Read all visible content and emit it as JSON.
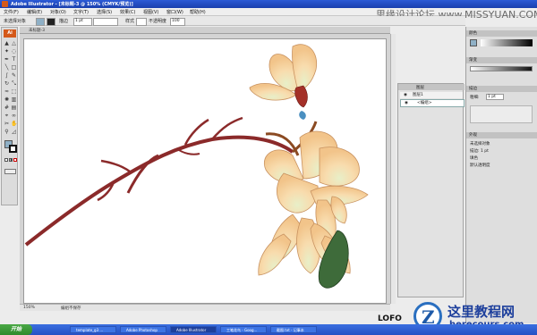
{
  "window": {
    "title": "Adobe Illustrator - [未标题-3 @ 150% (CMYK/预览)]"
  },
  "menu": [
    "文件(F)",
    "编辑(E)",
    "对象(O)",
    "文字(T)",
    "选择(S)",
    "效果(C)",
    "视图(V)",
    "窗口(W)",
    "帮助(H)"
  ],
  "control_bar": {
    "selection_label": "未选择对象",
    "stroke_label": "描边",
    "stroke_value": "1 pt",
    "opacity_label": "不透明度",
    "opacity_value": "100",
    "style_label": "样式"
  },
  "watermark_top": "思缘设计论坛 www.MISSYUAN.COM",
  "document_tab": "未标题-3",
  "toolbox": {
    "logo": "Ai"
  },
  "status": {
    "zoom": "150%",
    "status_text": "编组不保存"
  },
  "layers_panel": {
    "title": "图层",
    "rows": [
      "图层1",
      "<编组>"
    ]
  },
  "right_panels": {
    "swatch_header": "颜色",
    "gradient_header": "渐变",
    "stroke_header": "描边",
    "appearance_header": "外观",
    "appearance_items": [
      "未选择对象",
      "描边: 1 pt",
      "填色",
      "默认透明度"
    ],
    "stroke_weight_label": "粗细:",
    "stroke_weight_value": "1 pt"
  },
  "taskbar": {
    "start": "开始",
    "buttons": [
      "template_g3 ...",
      "Adobe Photoshop",
      "Adobe Illustrator",
      "工笔花鸟 - Goog...",
      "截图.txt - 记事本"
    ]
  },
  "branding": {
    "lofo": "LOFO",
    "site_name": "这里教程网",
    "site_url": "herecours.com"
  },
  "colors": {
    "accent": "#d4591a",
    "titlebar": "#1a3fae",
    "taskbar": "#2550c4",
    "branch": "#8b2a2a",
    "petal": "#f6d29e",
    "leaf": "#3e6b3a"
  }
}
